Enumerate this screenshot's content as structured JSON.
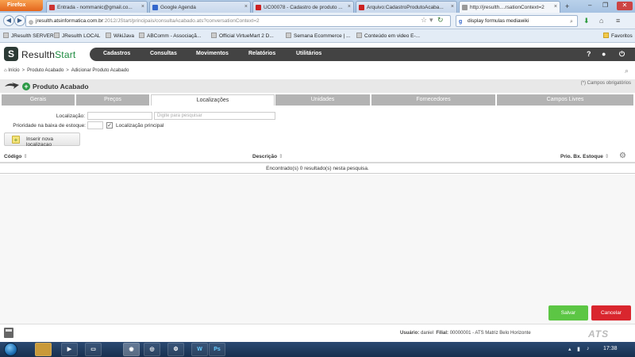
{
  "browser": {
    "app_button": "Firefox",
    "tabs": [
      {
        "label": "Entrada - nommanic@gmail.co...",
        "color": "#cc3333"
      },
      {
        "label": "Google Agenda",
        "color": "#3366cc"
      },
      {
        "label": "UC00078 - Cadastro de produto ...",
        "color": "#cc2222"
      },
      {
        "label": "Arquivo:CadastroProdutoAcaba...",
        "color": "#cc2222"
      },
      {
        "label": "http://jresulth....rsationContext=2",
        "color": "#999999"
      }
    ],
    "new_tab": "+",
    "url_host": "jresulth.atsinformatica.com.br",
    "url_rest": ":2012/JStart/principais/consultaAcabado.ats?conversationContext=2",
    "search_value": "display formulas mediawiki",
    "bookmarks": [
      "JResulth SERVER",
      "JResulth LOCAL",
      "WikiJava",
      "ABComm - Associaçã...",
      "Official VirtueMart 2 D...",
      "Semana Ecommerce | ...",
      "Conteúdo em video E-..."
    ],
    "bookmarks_right": "Favoritos"
  },
  "app": {
    "logo_s": "S",
    "logo_brand": "Resulth",
    "logo_start": "Start",
    "menu": [
      "Cadastros",
      "Consultas",
      "Movimentos",
      "Relatórios",
      "Utilitários"
    ],
    "help": "?"
  },
  "breadcrumb": [
    "Início",
    "Produto Acabado",
    "Adicionar Produto Acabado"
  ],
  "page": {
    "title": "Produto Acabado",
    "required_note": "(*) Campos obrigatórios"
  },
  "tabs": [
    "Gerais",
    "Preços",
    "Localizações",
    "Unidades",
    "Fornecedores",
    "Campos Livres"
  ],
  "active_tab": "Localizações",
  "form": {
    "localizacao_label": "Localização:",
    "localizacao_value": "",
    "search_placeholder": "Digite para pesquisar",
    "prioridade_label": "Prioridade na baixa de estoque:",
    "prioridade_value": "",
    "principal_checked": true,
    "principal_label": "Localização principal",
    "insert_button": "Inserir nova localizacao"
  },
  "table": {
    "columns": [
      "Código",
      "Descrição",
      "Prio. Bx. Estoque"
    ],
    "empty_message": "Encontrado(s) 0 resultado(s) nesta pesquisa."
  },
  "actions": {
    "save": "Salvar",
    "cancel": "Cancelar",
    "save_color": "#5cc644",
    "cancel_color": "#d9262e"
  },
  "footer": {
    "user_label": "Usuário:",
    "user": "daniel",
    "branch_label": "Filial:",
    "branch": "00000001 - ATS Matriz Belo Horizonte",
    "brand": "ATS"
  },
  "taskbar": {
    "apps": [
      "Explorer",
      "Media",
      "Files",
      "Firefox",
      "Chrome",
      "Settings",
      "Network",
      "Word",
      "Photoshop"
    ],
    "clock": "17:38"
  }
}
